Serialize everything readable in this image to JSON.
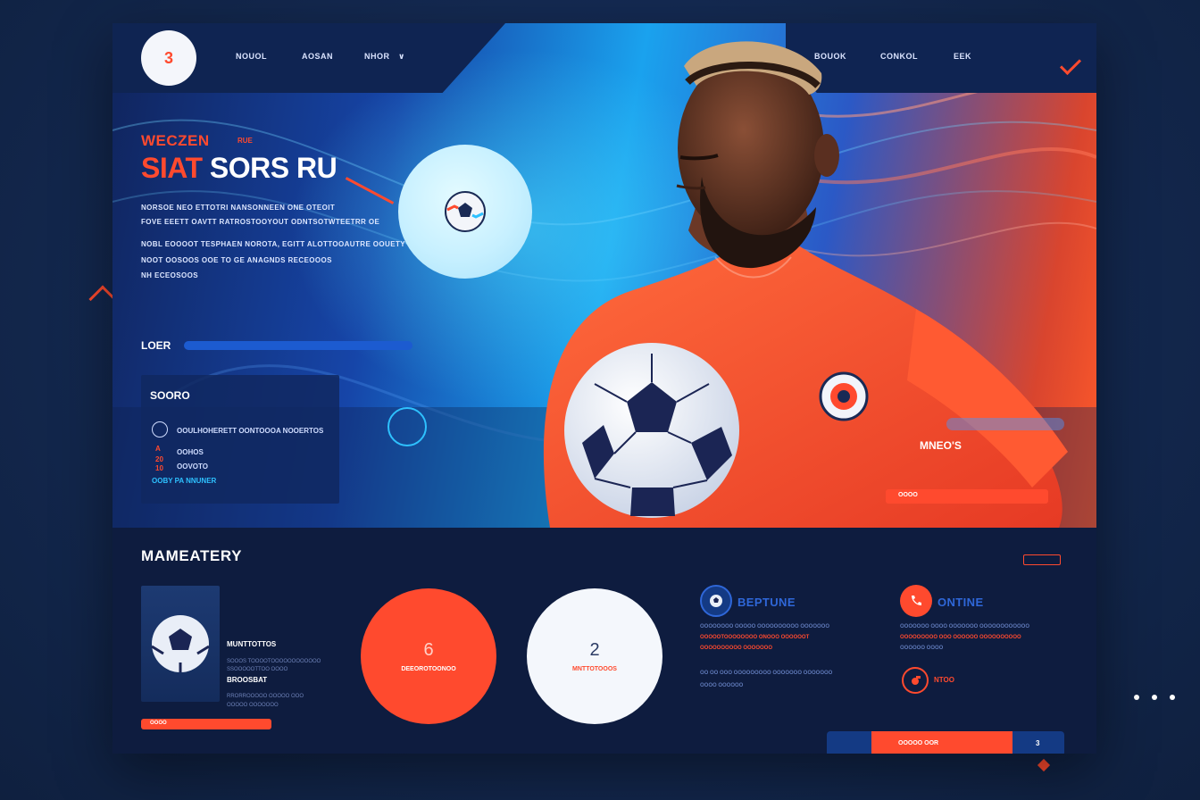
{
  "nav": {
    "logo": "3",
    "left_links": [
      "NOUOL",
      "AOSAN",
      "NHOR"
    ],
    "left_chevron": "∨",
    "right_links": [
      "BOUOK",
      "CONKOL",
      "EEK"
    ]
  },
  "hero": {
    "eyebrow": "WECZEN",
    "eyebrow_tag": "RUE",
    "headline_accent": "SIAT",
    "headline_rest": "SORS RU",
    "body_lines": [
      "NORSOE NEO ETTOTRI NANSONNEEN ONE OTEOIT",
      "FOVE EEETT OAVTT RATROSTOOYOUT ODNTSOTWTEETRR OE",
      "NOBL EOOOOT TESPHAEN NOROTA, EGITT ALOTTOOAUTRE OOUETY",
      "NOOT OOSOOS OOE TO GE ANAGNDS RECEOOOS",
      "NH ECEOSOOS"
    ],
    "loader_label": "LOER",
    "info_card": {
      "title": "SOORO",
      "rows": [
        "OOULHOHERETT OONTOOOA NOOERTOS",
        "OOHOS",
        "OOVOTO"
      ],
      "mini_marks": [
        "A",
        "20",
        "10"
      ],
      "link": "OOBY PA NNUNER"
    },
    "right_label": "MNEO'S",
    "cta": "OOOO"
  },
  "lower": {
    "title": "MAMEATERY",
    "thumb": {
      "title": "MUNTTOTTOS",
      "sub1": "SOOOS TOOOOTOOOOOOOOOOOO",
      "sub2": "SSOOOOOTTOO OOOO",
      "title2": "BROOSBAT",
      "sub3": "RRORROOOOO OOOOO OOO",
      "sub4": "OOOOO OOOOOOO"
    },
    "small_btn": "OOOO",
    "stat_red": {
      "num": "6",
      "label": "DEEOROTOONOO"
    },
    "stat_white": {
      "num": "2",
      "label": "MNTTOTOOOS"
    },
    "feature1": {
      "title": "BEPTUNE",
      "lines": [
        "OOOOOOOO OOOOO OOOOOOOOOO OOOOOOO",
        "OOOOOTOOOOOOOO ONOOO OOOOOOT",
        "OOOOOOOOOO OOOOOOO",
        "OO OO OOO OOOOOOOOO OOOOOOO OOOOOOO",
        "OOOO OOOOOO"
      ]
    },
    "feature2": {
      "title": "ONTINE",
      "lines": [
        "OOOOOOO OOOO OOOOOOO OOOOOOOOOOOO",
        "OOOOOOOOO OOO OOOOOO OOOOOOOOOO",
        "OOOOOO OOOO"
      ],
      "sub_title": "NTOO"
    },
    "split_bar": {
      "label": "OOOOO OOR",
      "count": "3"
    }
  },
  "colors": {
    "accent": "#ff4a2e",
    "navy": "#0e1c3f",
    "cyan": "#2ec1ff",
    "blue": "#1c5bd0"
  }
}
